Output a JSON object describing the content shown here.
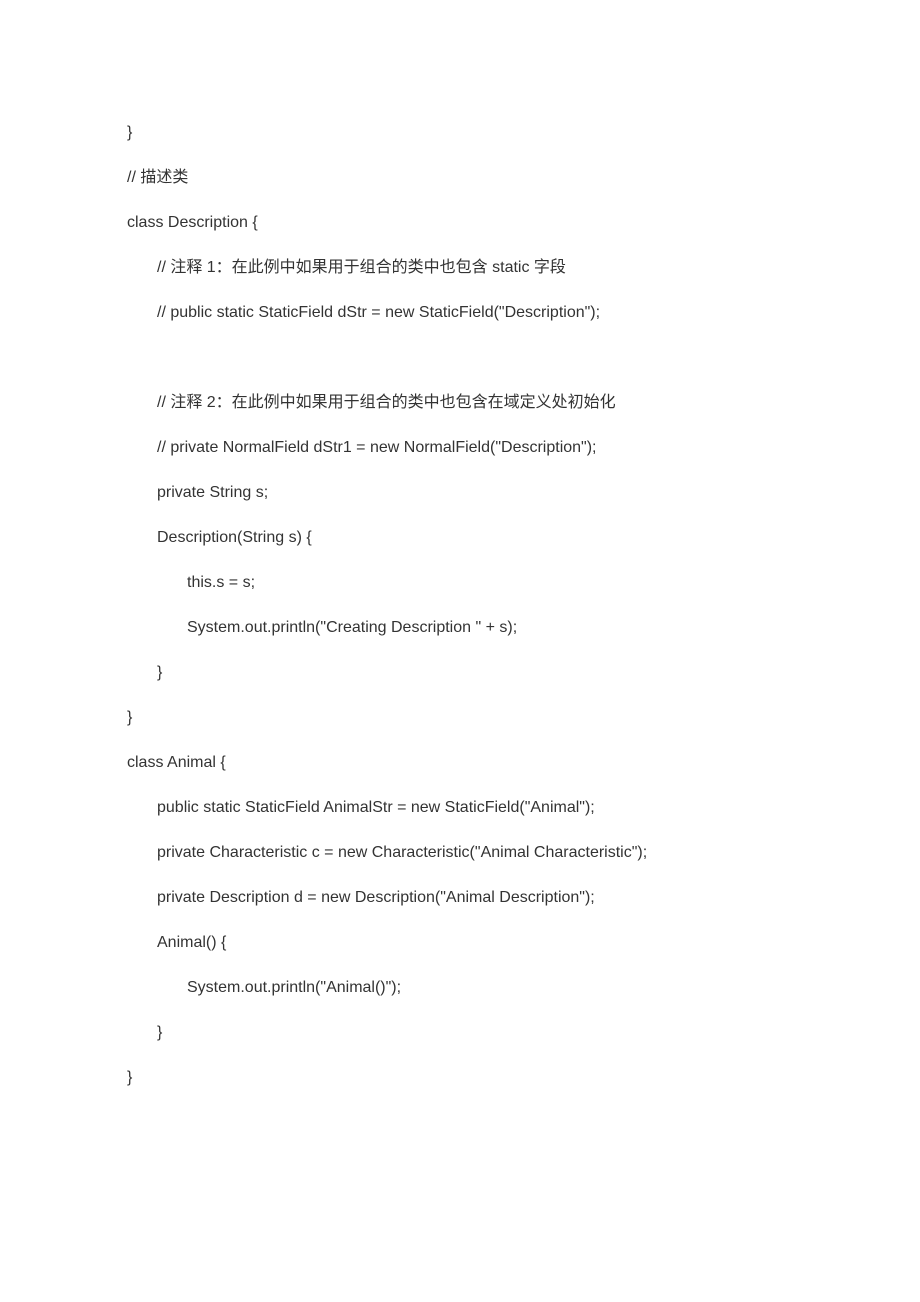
{
  "lines": [
    {
      "indent": 0,
      "text": "}"
    },
    {
      "indent": 0,
      "text": "// 描述类"
    },
    {
      "indent": 0,
      "text": "class Description {"
    },
    {
      "indent": 1,
      "text": "// 注释 1：在此例中如果用于组合的类中也包含 static 字段"
    },
    {
      "indent": 1,
      "text": "// public static StaticField dStr = new StaticField(\"Description\");"
    },
    {
      "indent": 0,
      "text": "",
      "blank": true
    },
    {
      "indent": 1,
      "text": "// 注释 2：在此例中如果用于组合的类中也包含在域定义处初始化"
    },
    {
      "indent": 1,
      "text": "// private NormalField dStr1 = new NormalField(\"Description\");"
    },
    {
      "indent": 1,
      "text": "private String s;"
    },
    {
      "indent": 1,
      "text": "Description(String s) {"
    },
    {
      "indent": 2,
      "text": "this.s = s;"
    },
    {
      "indent": 2,
      "text": "System.out.println(\"Creating Description \" + s);"
    },
    {
      "indent": 1,
      "text": "}"
    },
    {
      "indent": 0,
      "text": "}"
    },
    {
      "indent": 0,
      "text": "class Animal {"
    },
    {
      "indent": 1,
      "text": "public static StaticField AnimalStr = new StaticField(\"Animal\");"
    },
    {
      "indent": 1,
      "text": "private Characteristic c = new Characteristic(\"Animal Characteristic\");"
    },
    {
      "indent": 1,
      "text": "private Description d = new Description(\"Animal Description\");"
    },
    {
      "indent": 1,
      "text": "Animal() {"
    },
    {
      "indent": 2,
      "text": "System.out.println(\"Animal()\");"
    },
    {
      "indent": 1,
      "text": "}"
    },
    {
      "indent": 0,
      "text": "}"
    }
  ]
}
